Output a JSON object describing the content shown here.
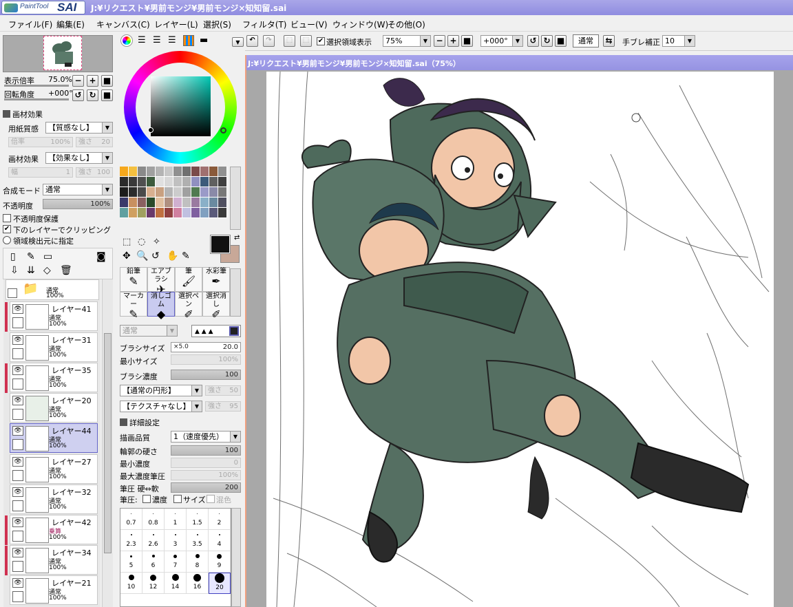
{
  "app": {
    "logo_text": "PaintTool",
    "logo_sai": "SAI",
    "title": "J:¥リクエスト¥男前モンジ¥男前モンジ×知知留.sai"
  },
  "menu": [
    "ファイル(F)",
    "編集(E)",
    "キャンバス(C)",
    "レイヤー(L)",
    "選択(S)",
    "フィルタ(T)",
    "ビュー(V)",
    "ウィンドウ(W)",
    "その他(O)"
  ],
  "navigator": {
    "zoom_label": "表示倍率",
    "zoom_value": "75.0%",
    "rotate_label": "回転角度",
    "rotate_value": "+000°"
  },
  "paper": {
    "section_label": "画材効果",
    "texture_label": "用紙質感",
    "texture_value": "【質感なし】",
    "scale_label": "倍率",
    "scale_value": "100%",
    "strength_label": "強さ",
    "strength_value": "20",
    "effect_label": "画材効果",
    "effect_value": "【効果なし】",
    "width_label": "幅",
    "width_value": "1",
    "effect_strength_value": "100"
  },
  "layer_props": {
    "blend_label": "合成モード",
    "blend_value": "通常",
    "opacity_label": "不透明度",
    "opacity_value": "100%",
    "protect_label": "不透明度保護",
    "clip_label": "下のレイヤーでクリッピング",
    "source_label": "領域検出元に指定"
  },
  "layers": [
    {
      "name": "",
      "mode": "通常",
      "opacity": "100%",
      "type": "folder"
    },
    {
      "name": "レイヤー41",
      "mode": "通常",
      "opacity": "100%",
      "marked": true
    },
    {
      "name": "レイヤー31",
      "mode": "通常",
      "opacity": "100%",
      "marked": false
    },
    {
      "name": "レイヤー35",
      "mode": "通常",
      "opacity": "100%",
      "marked": true
    },
    {
      "name": "レイヤー20",
      "mode": "通常",
      "opacity": "100%",
      "marked": false
    },
    {
      "name": "レイヤー44",
      "mode": "通常",
      "opacity": "100%",
      "marked": false,
      "selected": true
    },
    {
      "name": "レイヤー27",
      "mode": "通常",
      "opacity": "100%",
      "marked": false
    },
    {
      "name": "レイヤー32",
      "mode": "通常",
      "opacity": "100%",
      "marked": false
    },
    {
      "name": "レイヤー42",
      "mode": "乗算",
      "opacity": "100%",
      "marked": true
    },
    {
      "name": "レイヤー34",
      "mode": "通常",
      "opacity": "100%",
      "marked": true
    },
    {
      "name": "レイヤー21",
      "mode": "通常",
      "opacity": "100%",
      "marked": false
    }
  ],
  "colors": {
    "title_bar": "#9a97e6",
    "selection": "#cfd0f0",
    "primary": "#111111",
    "secondary": "#c8a898"
  },
  "swatches": [
    "#f6a81c",
    "#f4c040",
    "#8a8a8a",
    "#a0a0a0",
    "#b4b4b4",
    "#c8c8c8",
    "#909090",
    "#707070",
    "#7a4a4a",
    "#a07070",
    "#8a5a3a",
    "#909090",
    "#2a2a2a",
    "#3a3a3a",
    "#505050",
    "#3c5a3c",
    "#e0e0e0",
    "#d8d8d8",
    "#c0c0c0",
    "#b0b0b0",
    "#9090c0",
    "#3c5a7a",
    "#606060",
    "#404040",
    "#1c1c1c",
    "#2c2c2c",
    "#4a4a4a",
    "#d8b090",
    "#c8a080",
    "#b4b4b4",
    "#cccccc",
    "#a0a0a0",
    "#507a50",
    "#9a9ac8",
    "#8a8aa8",
    "#787878",
    "#3a3a6a",
    "#c89060",
    "#8a6060",
    "#2a4a2a",
    "#e0c0a0",
    "#b09080",
    "#d0b0d0",
    "#c0c0c0",
    "#9a7aa0",
    "#8ab0c8",
    "#6a8aa0",
    "#505060",
    "#60a0a0",
    "#d0a060",
    "#a0a060",
    "#6a3a6a",
    "#c07040",
    "#904040",
    "#d080a0",
    "#c0c0e0",
    "#8060a0",
    "#80a0c0",
    "#5a5a7a",
    "#3a3a3a"
  ],
  "tools": [
    {
      "label": "鉛筆",
      "icon": "pencil-icon"
    },
    {
      "label": "エアブラシ",
      "icon": "airbrush-icon"
    },
    {
      "label": "筆",
      "icon": "brush-icon"
    },
    {
      "label": "水彩筆",
      "icon": "watercolor-icon"
    },
    {
      "label": "マーカー",
      "icon": "marker-icon"
    },
    {
      "label": "消しゴム",
      "icon": "eraser-icon",
      "selected": true
    },
    {
      "label": "選択ペン",
      "icon": "select-pen-icon"
    },
    {
      "label": "選択消し",
      "icon": "select-erase-icon"
    }
  ],
  "brush": {
    "blend_value": "通常",
    "size_label": "ブラシサイズ",
    "size_mult": "×5.0",
    "size_value": "20.0",
    "min_size_label": "最小サイズ",
    "min_size_value": "100%",
    "density_label": "ブラシ濃度",
    "density_value": "100",
    "shape_value": "【通常の円形】",
    "shape_strength_label": "強さ",
    "shape_strength_value": "50",
    "texture_value": "【テクスチャなし】",
    "texture_strength_label": "強さ",
    "texture_strength_value": "95",
    "detail_label": "詳細設定",
    "quality_label": "描画品質",
    "quality_value": "1（速度優先）",
    "hardness_label": "輪郭の硬さ",
    "hardness_value": "100",
    "min_density_label": "最小濃度",
    "min_density_value": "0",
    "max_pressure_label": "最大濃度筆圧",
    "max_pressure_value": "100%",
    "pressure_label": "筆圧 硬⇔軟",
    "pressure_value": "200",
    "pen_label": "筆圧:",
    "pen_density": "濃度",
    "pen_size": "サイズ",
    "pen_blend": "混色"
  },
  "brush_sizes": [
    "0.7",
    "0.8",
    "1",
    "1.5",
    "2",
    "2.3",
    "2.6",
    "3",
    "3.5",
    "4",
    "5",
    "6",
    "7",
    "8",
    "9",
    "10",
    "12",
    "14",
    "16",
    "20"
  ],
  "toolbar": {
    "selection_label": "選択領域表示",
    "zoom_value": "75%",
    "angle_value": "+000°",
    "mode_label": "通常",
    "stabilizer_label": "手ブレ補正",
    "stabilizer_value": "10"
  },
  "document": {
    "title": "J:¥リクエスト¥男前モンジ¥男前モンジ×知知留.sai（75%）"
  }
}
